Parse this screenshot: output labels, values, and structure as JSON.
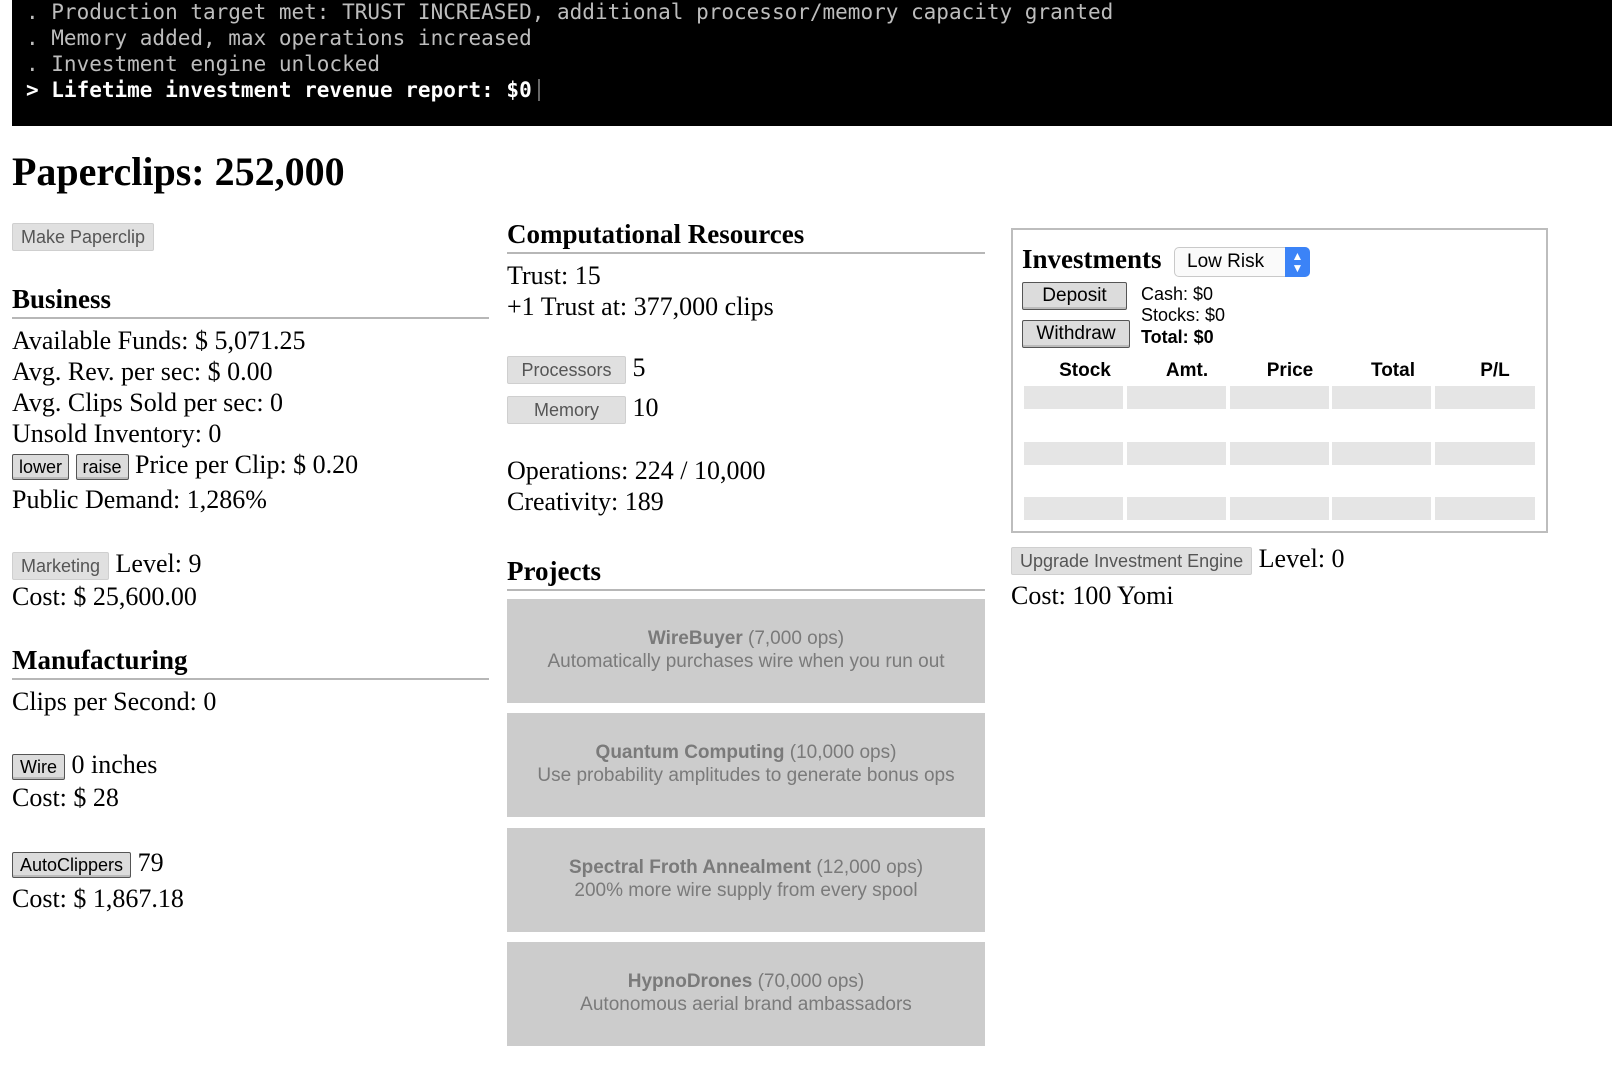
{
  "console": {
    "lines": [
      ". Production target met: TRUST INCREASED, additional processor/memory capacity granted",
      ". Memory added, max operations increased",
      ". Investment engine unlocked"
    ],
    "last_line": "> Lifetime investment revenue report: $0"
  },
  "header": {
    "paperclips": "Paperclips: 252,000"
  },
  "make_paperclip": {
    "label": "Make Paperclip"
  },
  "business": {
    "title": "Business",
    "available_funds": "Available Funds: $ 5,071.25",
    "avg_rev": "Avg. Rev. per sec: $ 0.00",
    "avg_clips_sold": "Avg. Clips Sold per sec: 0",
    "unsold_inventory": "Unsold Inventory: 0",
    "lower_label": "lower",
    "raise_label": "raise",
    "price_per_clip": "Price per Clip: $ 0.20",
    "public_demand": "Public Demand: 1,286%",
    "marketing_label": "Marketing",
    "marketing_level": "Level: 9",
    "marketing_cost": "Cost: $ 25,600.00"
  },
  "manufacturing": {
    "title": "Manufacturing",
    "clips_per_second": "Clips per Second: 0",
    "wire_label": "Wire",
    "wire_amount": "0 inches",
    "wire_cost": "Cost: $ 28",
    "autoclippers_label": "AutoClippers",
    "autoclippers_count": "79",
    "autoclippers_cost": "Cost: $ 1,867.18"
  },
  "computational": {
    "title": "Computational Resources",
    "trust": "Trust: 15",
    "next_trust": "+1 Trust at: 377,000 clips",
    "processors_label": "Processors",
    "processors_value": "5",
    "memory_label": "Memory",
    "memory_value": "10",
    "operations": "Operations: 224 / 10,000",
    "creativity": "Creativity: 189"
  },
  "projects": {
    "title": "Projects",
    "items": [
      {
        "name": "WireBuyer",
        "cost": " (7,000 ops)",
        "desc": "Automatically purchases wire when you run out"
      },
      {
        "name": "Quantum Computing",
        "cost": " (10,000 ops)",
        "desc": "Use probability amplitudes to generate bonus ops"
      },
      {
        "name": "Spectral Froth Annealment",
        "cost": " (12,000 ops)",
        "desc": "200% more wire supply from every spool"
      },
      {
        "name": "HypnoDrones",
        "cost": " (70,000 ops)",
        "desc": "Autonomous aerial brand ambassadors"
      }
    ]
  },
  "investments": {
    "title": "Investments",
    "risk_selected": "Low Risk",
    "deposit_label": "Deposit",
    "withdraw_label": "Withdraw",
    "cash": "Cash: $0",
    "stocks": "Stocks: $0",
    "total": "Total: $0",
    "columns": [
      "Stock",
      "Amt.",
      "Price",
      "Total",
      "P/L"
    ],
    "upgrade_label": "Upgrade Investment Engine",
    "engine_level": "Level: 0",
    "engine_cost": "Cost: 100 Yomi"
  },
  "colors": {
    "console_bg": "#000000",
    "project_bg": "#cccccc",
    "select_accent": "#3b83f7"
  }
}
